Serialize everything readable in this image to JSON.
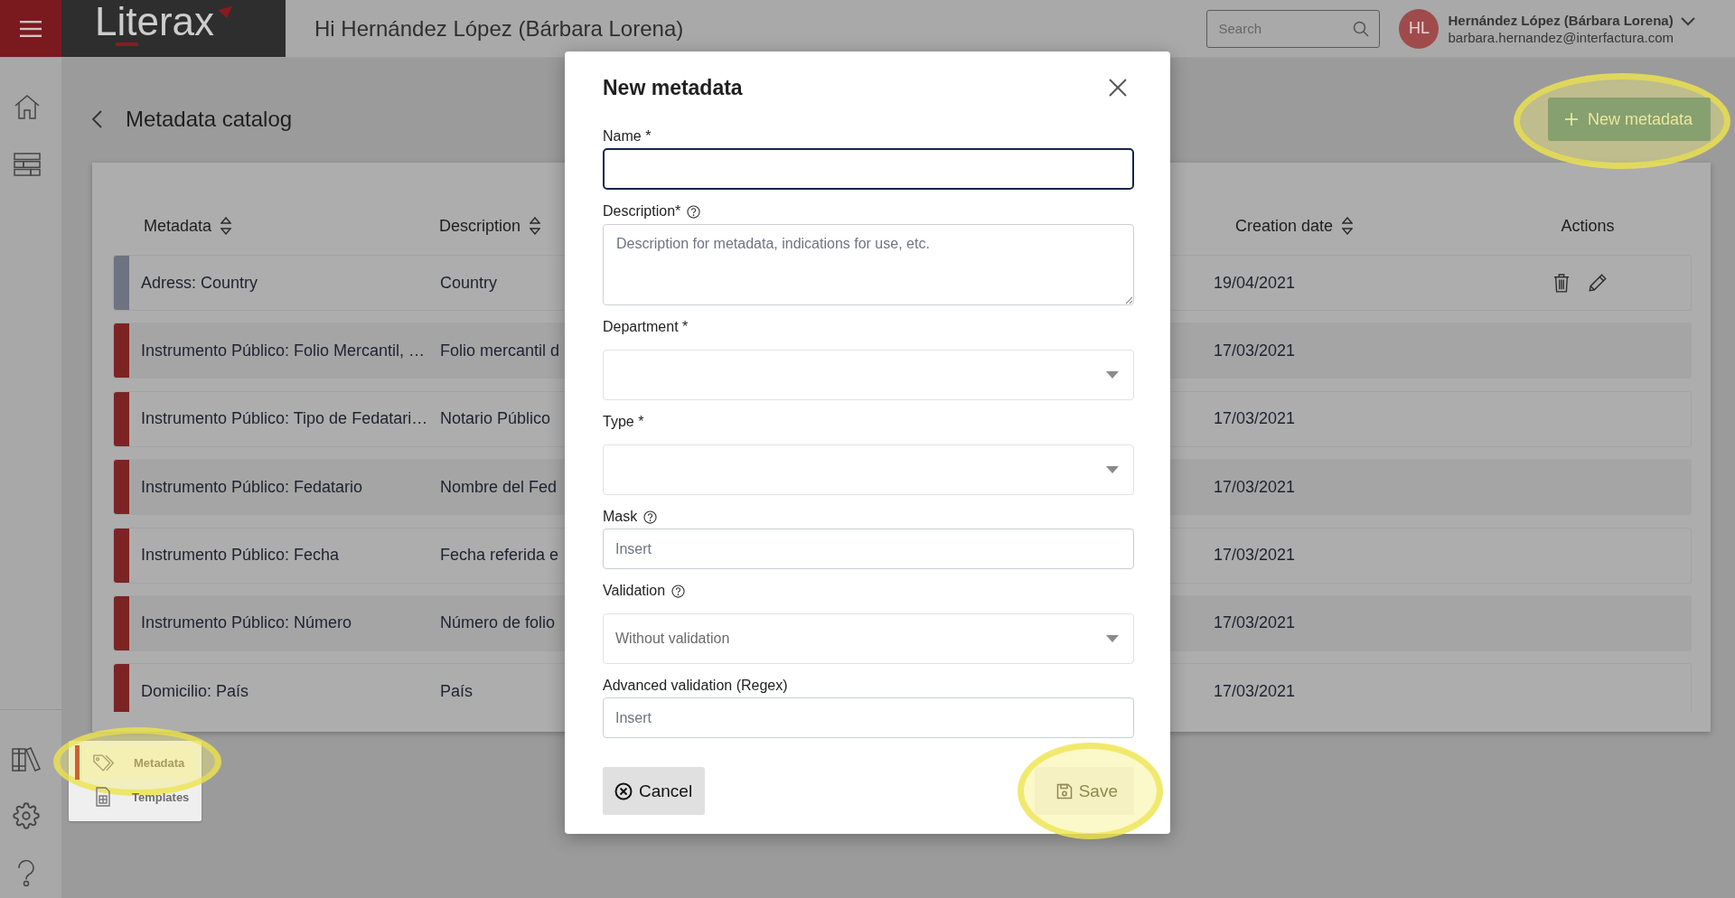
{
  "top_bar": {
    "logo": "Literax",
    "greeting": "Hi Hernández López (Bárbara Lorena)",
    "search": {
      "placeholder": "Search"
    },
    "user": {
      "initials": "HL",
      "name": "Hernández López (Bárbara Lorena)",
      "email": "barbara.hernandez@interfactura.com"
    }
  },
  "page": {
    "title": "Metadata catalog",
    "new_button": {
      "label": "New metadata",
      "highlighted": true
    }
  },
  "table": {
    "columns": [
      {
        "label": "Metadata",
        "sortable": true
      },
      {
        "label": "Description",
        "sortable": true
      },
      {
        "label": "Creation date",
        "sortable": true
      },
      {
        "label": "Actions",
        "sortable": false
      }
    ],
    "rows": [
      {
        "metadata": "Adress: Country",
        "description": "Country",
        "creation_date": "19/04/2021",
        "color": "#6e7382",
        "show_actions": true
      },
      {
        "metadata": "Instrumento Público: Folio Mercantil, …",
        "description": "Folio mercantil d",
        "creation_date": "17/03/2021",
        "color": "#7c2424",
        "show_actions": false
      },
      {
        "metadata": "Instrumento Público: Tipo de Fedatari…",
        "description": "Notario Público",
        "creation_date": "17/03/2021",
        "color": "#7c2424",
        "show_actions": false
      },
      {
        "metadata": "Instrumento Público: Fedatario",
        "description": "Nombre del Fed",
        "creation_date": "17/03/2021",
        "color": "#7c2424",
        "show_actions": false
      },
      {
        "metadata": "Instrumento Público: Fecha",
        "description": "Fecha referida e",
        "creation_date": "17/03/2021",
        "color": "#7c2424",
        "show_actions": false
      },
      {
        "metadata": "Instrumento Público: Número",
        "description": "Número de folio",
        "creation_date": "17/03/2021",
        "color": "#7c2424",
        "show_actions": false
      },
      {
        "metadata": "Domicilio: País",
        "description": "País",
        "creation_date": "17/03/2021",
        "color": "#7c2424",
        "show_actions": false
      }
    ]
  },
  "flyout_menu": {
    "items": [
      {
        "label": "Metadata",
        "selected": true,
        "highlighted": true
      },
      {
        "label": "Templates",
        "selected": false,
        "highlighted": false
      }
    ]
  },
  "modal": {
    "title": "New metadata",
    "fields": [
      {
        "kind": "input",
        "label": "Name *",
        "help": false,
        "focused": true
      },
      {
        "kind": "textarea",
        "label": "Description*",
        "help": true,
        "placeholder": "Description for metadata, indications for use, etc.",
        "focused": false
      },
      {
        "kind": "select",
        "label": "Department *",
        "help": false,
        "focused": false
      },
      {
        "kind": "select",
        "label": "Type *",
        "help": false,
        "focused": false
      },
      {
        "kind": "input",
        "label": "Mask",
        "help": true,
        "placeholder": "Insert",
        "focused": false
      },
      {
        "kind": "select",
        "label": "Validation",
        "help": true,
        "value": "Without validation",
        "focused": false
      },
      {
        "kind": "input",
        "label": "Advanced validation (Regex)",
        "help": false,
        "placeholder": "Insert",
        "focused": false
      }
    ],
    "buttons": [
      {
        "kind": "cancel",
        "label": "Cancel",
        "disabled": false,
        "highlighted": false
      },
      {
        "kind": "save",
        "label": "Save",
        "disabled": true,
        "highlighted": true
      }
    ]
  }
}
